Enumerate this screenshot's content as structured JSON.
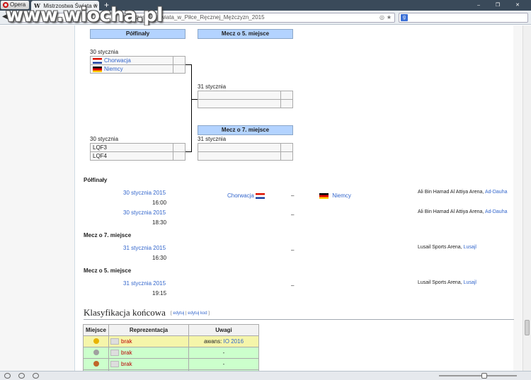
{
  "browser": {
    "menu_label": "Opera",
    "tab_title": "Mistrzostwa Świata w P...",
    "tab_logo": "W",
    "tab_close": "×",
    "new_tab": "+",
    "window_controls": "‒ ❐ ✕",
    "back": "◀",
    "url": "/Mistrzostwa_Świata_w_Piłce_Ręcznej_Mężczyzn_2015",
    "search_engine": "g",
    "watermark": "www.wiocha.pl"
  },
  "bracket": {
    "semi_header": "Półfinały",
    "fifth_header": "Mecz o 5. miejsce",
    "seventh_header": "Mecz o 7. miejsce",
    "semi1_date": "30 stycznia",
    "semi1_team1": "Chorwacja",
    "semi1_team2": "Niemcy",
    "semi2_date": "30 stycznia",
    "semi2_team1": "LQF3",
    "semi2_team2": "LQF4",
    "final_date": "31 stycznia",
    "seventh_date": "31 stycznia"
  },
  "matches": {
    "semi_title": "Półfinały",
    "seventh_title": "Mecz o 7. miejsce",
    "fifth_title": "Mecz o 5. miejsce",
    "dash": "–",
    "m1": {
      "date": "30 stycznia 2015",
      "time": "16:00",
      "team1": "Chorwacja",
      "team2": "Niemcy",
      "venue": "Ali Bin Hamad Al Attiya Arena, ",
      "city": "Ad-Dauha"
    },
    "m2": {
      "date": "30 stycznia 2015",
      "time": "18:30",
      "venue": "Ali Bin Hamad Al Attiya Arena, ",
      "city": "Ad-Dauha"
    },
    "m3": {
      "date": "31 stycznia 2015",
      "time": "16:30",
      "venue": "Lusail Sports Arena, ",
      "city": "Lusajl"
    },
    "m4": {
      "date": "31 stycznia 2015",
      "time": "19:15",
      "venue": "Lusail Sports Arena, ",
      "city": "Lusajl"
    }
  },
  "ranking": {
    "title": "Klasyfikacja końcowa",
    "edit_open": "[ ",
    "edit1": "edytuj",
    "edit_sep": " | ",
    "edit2": "edytuj kod",
    "edit_close": " ]",
    "col_place": "Miejsce",
    "col_team": "Reprezentacja",
    "col_notes": "Uwagi",
    "rows": [
      {
        "team": "brak",
        "note_prefix": "awans: ",
        "note_link": "IO 2016",
        "medal_color": "#e8b300"
      },
      {
        "team": "brak",
        "note_prefix": "",
        "note_link": "-",
        "medal_color": "#a0a0a0"
      },
      {
        "team": "brak",
        "note_prefix": "",
        "note_link": "-",
        "medal_color": "#c0662a"
      }
    ],
    "qmark": "?"
  },
  "colors": {
    "link": "#3366cc",
    "header_bg": "#b3d3ff"
  }
}
